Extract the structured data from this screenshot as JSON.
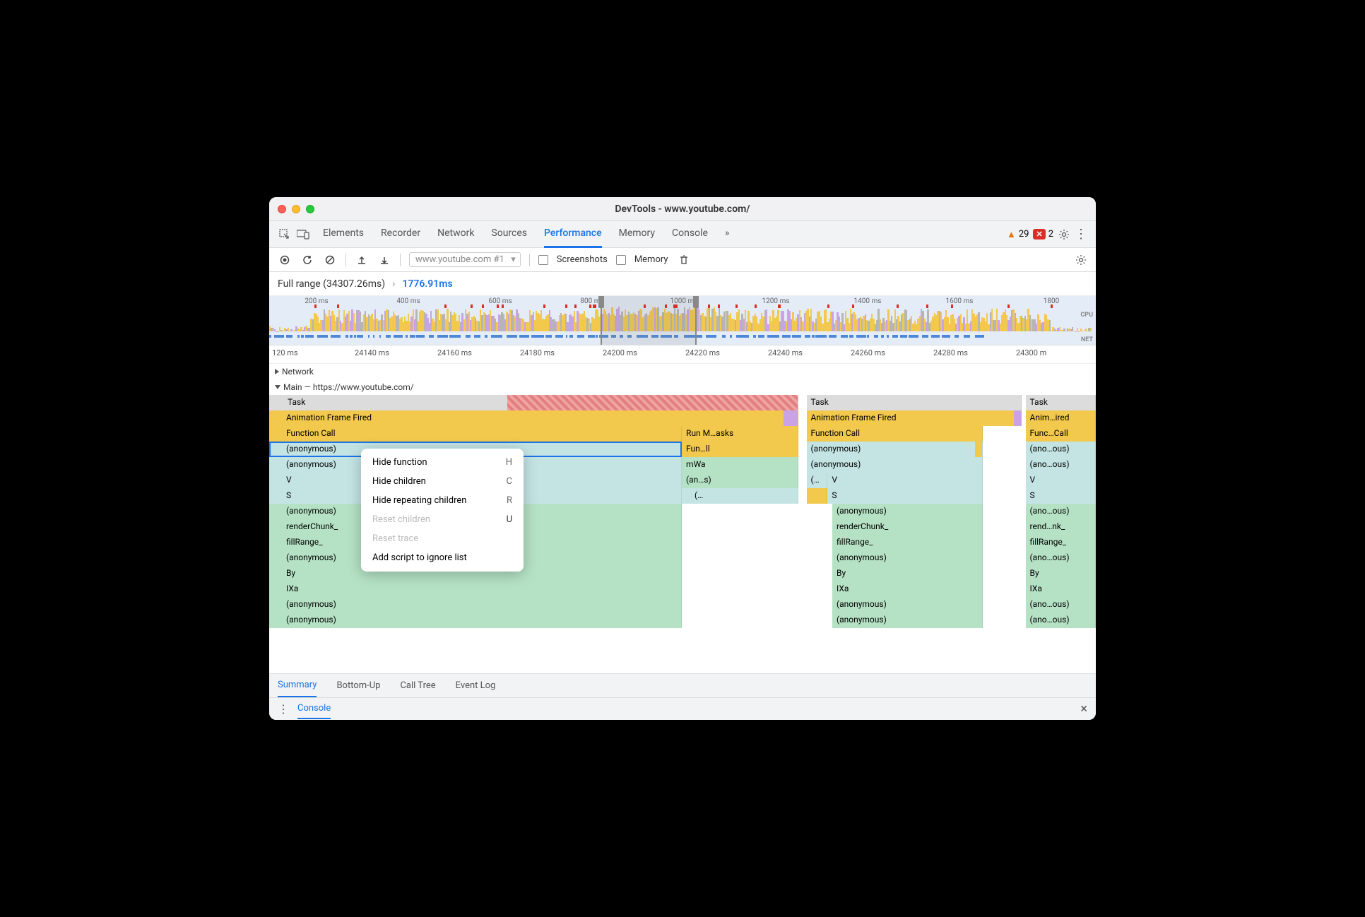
{
  "window": {
    "title": "DevTools - www.youtube.com/"
  },
  "toolbar": {
    "tabs": [
      {
        "label": "Elements"
      },
      {
        "label": "Recorder"
      },
      {
        "label": "Network"
      },
      {
        "label": "Sources"
      },
      {
        "label": "Performance",
        "active": true
      },
      {
        "label": "Memory"
      },
      {
        "label": "Console"
      }
    ],
    "more": "»",
    "warn_count": "29",
    "err_count": "2"
  },
  "perf_bar": {
    "recording_name": "www.youtube.com #1",
    "screenshots_label": "Screenshots",
    "memory_label": "Memory"
  },
  "range": {
    "full_label": "Full range (34307.26ms)",
    "chevron": "›",
    "selected": "1776.91ms"
  },
  "overview": {
    "ticks": [
      "200 ms",
      "400 ms",
      "600 ms",
      "800 ms",
      "1000 ms",
      "1200 ms",
      "1400 ms",
      "1600 ms",
      "1800"
    ],
    "cpu_label": "CPU",
    "net_label": "NET"
  },
  "detail_ticks": [
    "120 ms",
    "24140 ms",
    "24160 ms",
    "24180 ms",
    "24200 ms",
    "24220 ms",
    "24240 ms",
    "24260 ms",
    "24280 ms",
    "24300 m"
  ],
  "tracks": {
    "network": "Network",
    "main": "Main — https://www.youtube.com/"
  },
  "flame": {
    "task": "Task",
    "animation_frame": "Animation Frame Fired",
    "function_call": "Function Call",
    "anonymous": "(anonymous)",
    "v": "V",
    "s": "S",
    "render_chunk": "renderChunk_",
    "fill_range": "fillRange_",
    "by": "By",
    "ixa": "IXa",
    "run_tasks": "Run M…asks",
    "fun_ll": "Fun…ll",
    "mwa": "mWa",
    "ans": "(an…s)",
    "paren": "(…",
    "anim_ired": "Anim…ired",
    "func_call_short": "Func…Call",
    "ano_ous": "(ano…ous)",
    "rend_nk": "rend…nk_"
  },
  "ctx": {
    "hide_function": "Hide function",
    "hide_function_key": "H",
    "hide_children": "Hide children",
    "hide_children_key": "C",
    "hide_rep": "Hide repeating children",
    "hide_rep_key": "R",
    "reset_children": "Reset children",
    "reset_children_key": "U",
    "reset_trace": "Reset trace",
    "add_ignore": "Add script to ignore list"
  },
  "bottom_tabs": [
    {
      "label": "Summary",
      "active": true
    },
    {
      "label": "Bottom-Up"
    },
    {
      "label": "Call Tree"
    },
    {
      "label": "Event Log"
    }
  ],
  "console": {
    "label": "Console"
  }
}
